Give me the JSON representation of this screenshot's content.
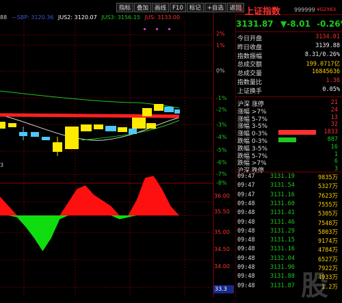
{
  "toolbar": {
    "buttons": [
      "指标",
      "叠加",
      "画线",
      "F10",
      "标记",
      "+自选",
      "返回"
    ]
  },
  "indicator_row": {
    "left_label": "88",
    "items": [
      {
        "text": "—SBP: 3120.36",
        "color": "#3a5ad0"
      },
      {
        "text": "JUS2: 3120.07",
        "color": "#ffffff"
      },
      {
        "text": "JUS3: 3156.15",
        "color": "#1ec81e"
      },
      {
        "text": "JUS: 3133.00",
        "color": "#ff3030"
      }
    ]
  },
  "chart_data": {
    "type": "candlestick",
    "y_axis_pct": [
      "2%",
      "1%",
      "0%",
      "-1%",
      "-2%",
      "-3%",
      "-4%",
      "-5%",
      "-6%",
      "-7%",
      "-8%"
    ],
    "lower_panel": {
      "type": "area",
      "y_labels": [
        "36.00",
        "35.50",
        "35.00",
        "34.50",
        "34.00"
      ],
      "values": [
        0.5,
        0.25,
        -0.05,
        -0.3,
        -0.6,
        -0.95,
        -0.6,
        -0.1,
        0.35,
        0.7,
        0.8,
        0.55,
        0.4,
        0.25,
        -0.1,
        -0.05,
        0.4,
        1.0,
        1.05,
        0.7,
        0.25,
        0.0
      ]
    },
    "left_small_label": "3",
    "box_label": "33.3"
  },
  "right_panel": {
    "g_mark": "G",
    "title": "上证指数",
    "code": "999999",
    "badge": "¥G2X63",
    "price": "3131.87",
    "change": "▼-8.01",
    "change_pct": "-0.26%",
    "stats": [
      {
        "k": "今日开盘",
        "v": "3134.01",
        "c": "red"
      },
      {
        "k": "昨日收盘",
        "v": "3139.88",
        "c": "white"
      },
      {
        "k": "指数振幅",
        "v": "8.31/0.26%",
        "c": "white"
      },
      {
        "k": "总成交额",
        "v": "199.0717亿",
        "c": "yellow"
      },
      {
        "k": "总成交量",
        "v": "16845636",
        "c": "yellow"
      },
      {
        "k": "指数量比",
        "v": "1.36",
        "c": "red"
      },
      {
        "k": "上证换手",
        "v": "0.05%",
        "c": "white"
      }
    ],
    "distribution": [
      {
        "k": "沪深 涨停",
        "v": "21",
        "c": "red"
      },
      {
        "k": "涨幅 >7%",
        "v": "24",
        "c": "red"
      },
      {
        "k": "涨幅 5-7%",
        "v": "13",
        "c": "red"
      },
      {
        "k": "涨幅 3-5%",
        "v": "32",
        "c": "red"
      },
      {
        "k": "涨幅 0-3%",
        "v": "1833",
        "c": "red",
        "bar": 0.5,
        "barc": "#ff3030"
      },
      {
        "k": "跌幅 0-3%",
        "v": "887",
        "c": "green",
        "bar": 0.24,
        "barc": "#1ec81e"
      },
      {
        "k": "跌幅 3-5%",
        "v": "16",
        "c": "green"
      },
      {
        "k": "跌幅 5-7%",
        "v": "1",
        "c": "green"
      },
      {
        "k": "跌幅 >7%",
        "v": "6",
        "c": "green"
      },
      {
        "k": "沪深 跌停",
        "v": "3",
        "c": "green"
      }
    ],
    "ticks": [
      {
        "t": "09:47",
        "p": "3131.19",
        "v": "9835万"
      },
      {
        "t": "09:47",
        "p": "3131.54",
        "v": "5327万"
      },
      {
        "t": "09:47",
        "p": "3131.16",
        "v": "7623万"
      },
      {
        "t": "09:48",
        "p": "3131.60",
        "v": "7555万"
      },
      {
        "t": "09:48",
        "p": "3131.41",
        "v": "5305万"
      },
      {
        "t": "09:48",
        "p": "3131.46",
        "v": "7548万"
      },
      {
        "t": "09:48",
        "p": "3131.29",
        "v": "5803万"
      },
      {
        "t": "09:48",
        "p": "3131.15",
        "v": "9174万"
      },
      {
        "t": "09:48",
        "p": "3131.16",
        "v": "4784万"
      },
      {
        "t": "09:48",
        "p": "3132.04",
        "v": "6527万"
      },
      {
        "t": "09:48",
        "p": "3131.96",
        "v": "7922万"
      },
      {
        "t": "09:48",
        "p": "3131.88",
        "v": "4933万"
      },
      {
        "t": "09:48",
        "p": "3131.87",
        "v": "1.2万"
      }
    ]
  }
}
